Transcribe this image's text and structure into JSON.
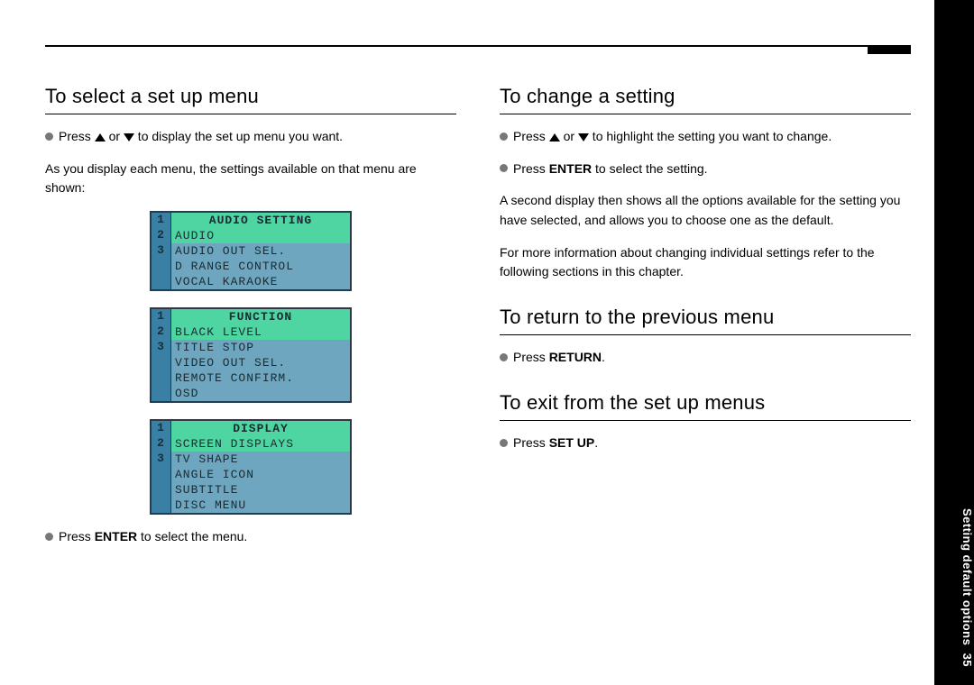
{
  "page_number": "35",
  "side_tab": "Setting default options",
  "sections": {
    "select": {
      "heading": "To select a set up menu",
      "press_line_pre": "Press ",
      "press_line_mid": " or ",
      "press_line_post": " to display the set up menu you want.",
      "intro": "As you display each menu, the settings available on that menu are shown:",
      "enter_pre": "Press ",
      "enter_bold": "ENTER",
      "enter_post": " to select the menu."
    },
    "change": {
      "heading": "To change a setting",
      "press_line_pre": "Press ",
      "press_line_mid": " or ",
      "press_line_post": " to highlight the setting you want to change.",
      "enter_pre": "Press ",
      "enter_bold": "ENTER",
      "enter_post": " to select the setting.",
      "para1": "A second display then shows all the options available for the setting you have selected, and allows you to choose one as the default.",
      "para2": "For more information about changing individual settings refer to the following sections in this chapter."
    },
    "return": {
      "heading": "To return to the previous menu",
      "press_pre": "Press ",
      "press_bold": "RETURN",
      "press_post": "."
    },
    "exit": {
      "heading": "To exit from the set up menus",
      "press_pre": "Press ",
      "press_bold": "SET UP",
      "press_post": "."
    }
  },
  "osd": {
    "menu1": {
      "nums": [
        "1",
        "2",
        "3"
      ],
      "title": "AUDIO SETTING",
      "items": [
        "AUDIO",
        "AUDIO OUT SEL.",
        "D RANGE CONTROL",
        "VOCAL KARAOKE"
      ]
    },
    "menu2": {
      "nums": [
        "1",
        "2",
        "3"
      ],
      "title": "FUNCTION",
      "items": [
        "BLACK LEVEL",
        "TITLE STOP",
        "VIDEO OUT SEL.",
        "REMOTE CONFIRM.",
        "OSD"
      ]
    },
    "menu3": {
      "nums": [
        "1",
        "2",
        "3"
      ],
      "title": "DISPLAY",
      "items": [
        "SCREEN DISPLAYS",
        "TV SHAPE",
        "ANGLE ICON",
        "SUBTITLE",
        "DISC MENU"
      ]
    }
  }
}
